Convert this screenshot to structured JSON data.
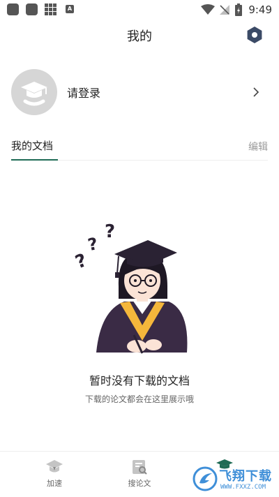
{
  "status_bar": {
    "time": "9:49",
    "notification_icons": [
      "app-icon",
      "app-icon",
      "grid-icon",
      "a-icon"
    ],
    "a_label": "A",
    "system_icons": [
      "wifi-icon",
      "no-signal-icon",
      "battery-icon"
    ]
  },
  "header": {
    "title": "我的",
    "settings_icon": "hexagon-settings-icon"
  },
  "user": {
    "login_label": "请登录",
    "avatar_icon": "graduate-avatar-icon"
  },
  "tabs": {
    "my_docs": "我的文档",
    "edit": "编辑"
  },
  "empty_state": {
    "title": "暂时没有下载的文档",
    "subtitle": "下载的论文都会在这里展示哦"
  },
  "bottom_nav": [
    {
      "label": "加速",
      "icon": "accelerate-icon"
    },
    {
      "label": "搜论文",
      "icon": "search-paper-icon"
    },
    {
      "label": "",
      "icon": "graduate-cap-icon"
    }
  ],
  "watermark": {
    "text": "飞翔下载",
    "url": "WWW.FXXZ.COM"
  },
  "colors": {
    "accent": "#1f6b55",
    "settings_icon": "#3b4a66",
    "avatar_bg": "#d6d6d6",
    "watermark": "#3f8fd8"
  }
}
